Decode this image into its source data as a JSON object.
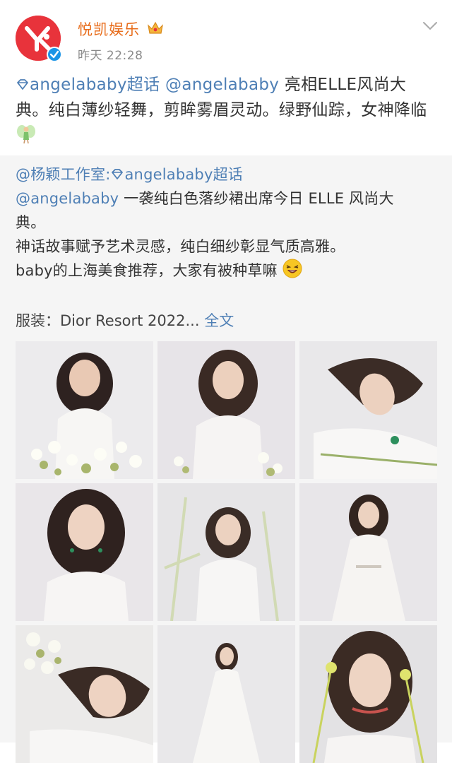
{
  "header": {
    "username": "悦凯娱乐",
    "timestamp": "昨天 22:28",
    "avatar_icon": "brand-logo-icon",
    "verified_icon": "verified-badge-icon",
    "crown_icon": "crown-icon",
    "menu_icon": "chevron-down-icon"
  },
  "post": {
    "topic": "angelababy超话",
    "mention": "@angelababy",
    "text_1": " 亮相ELLE风尚大典。纯白薄纱轻舞，剪眸雾眉灵动。绿野仙踪，女神降临",
    "fairy_icon": "fairy-emoji-icon"
  },
  "repost": {
    "author": "@杨颖工作室:",
    "topic": "angelababy超话",
    "mention": "@angelababy",
    "line_1": " 一袭纯白色落纱裙出席今日 ELLE 风尚大",
    "line_2": "典。",
    "line_3": "神话故事赋予艺术灵感，纯白细纱彰显气质高雅。",
    "line_4": "baby的上海美食推荐，大家有被种草嘛 ",
    "laugh_icon": "laughing-emoji-icon",
    "meta": "服装：Dior Resort 2022... ",
    "fulltext": "全文"
  },
  "colors": {
    "link": "#4e7fb5",
    "username": "#e86c1a",
    "brand": "#e8333b",
    "repost_bg": "#f5f5f5"
  },
  "photos": [
    {
      "name": "photo-1"
    },
    {
      "name": "photo-2"
    },
    {
      "name": "photo-3"
    },
    {
      "name": "photo-4"
    },
    {
      "name": "photo-5"
    },
    {
      "name": "photo-6"
    },
    {
      "name": "photo-7"
    },
    {
      "name": "photo-8"
    },
    {
      "name": "photo-9"
    }
  ]
}
